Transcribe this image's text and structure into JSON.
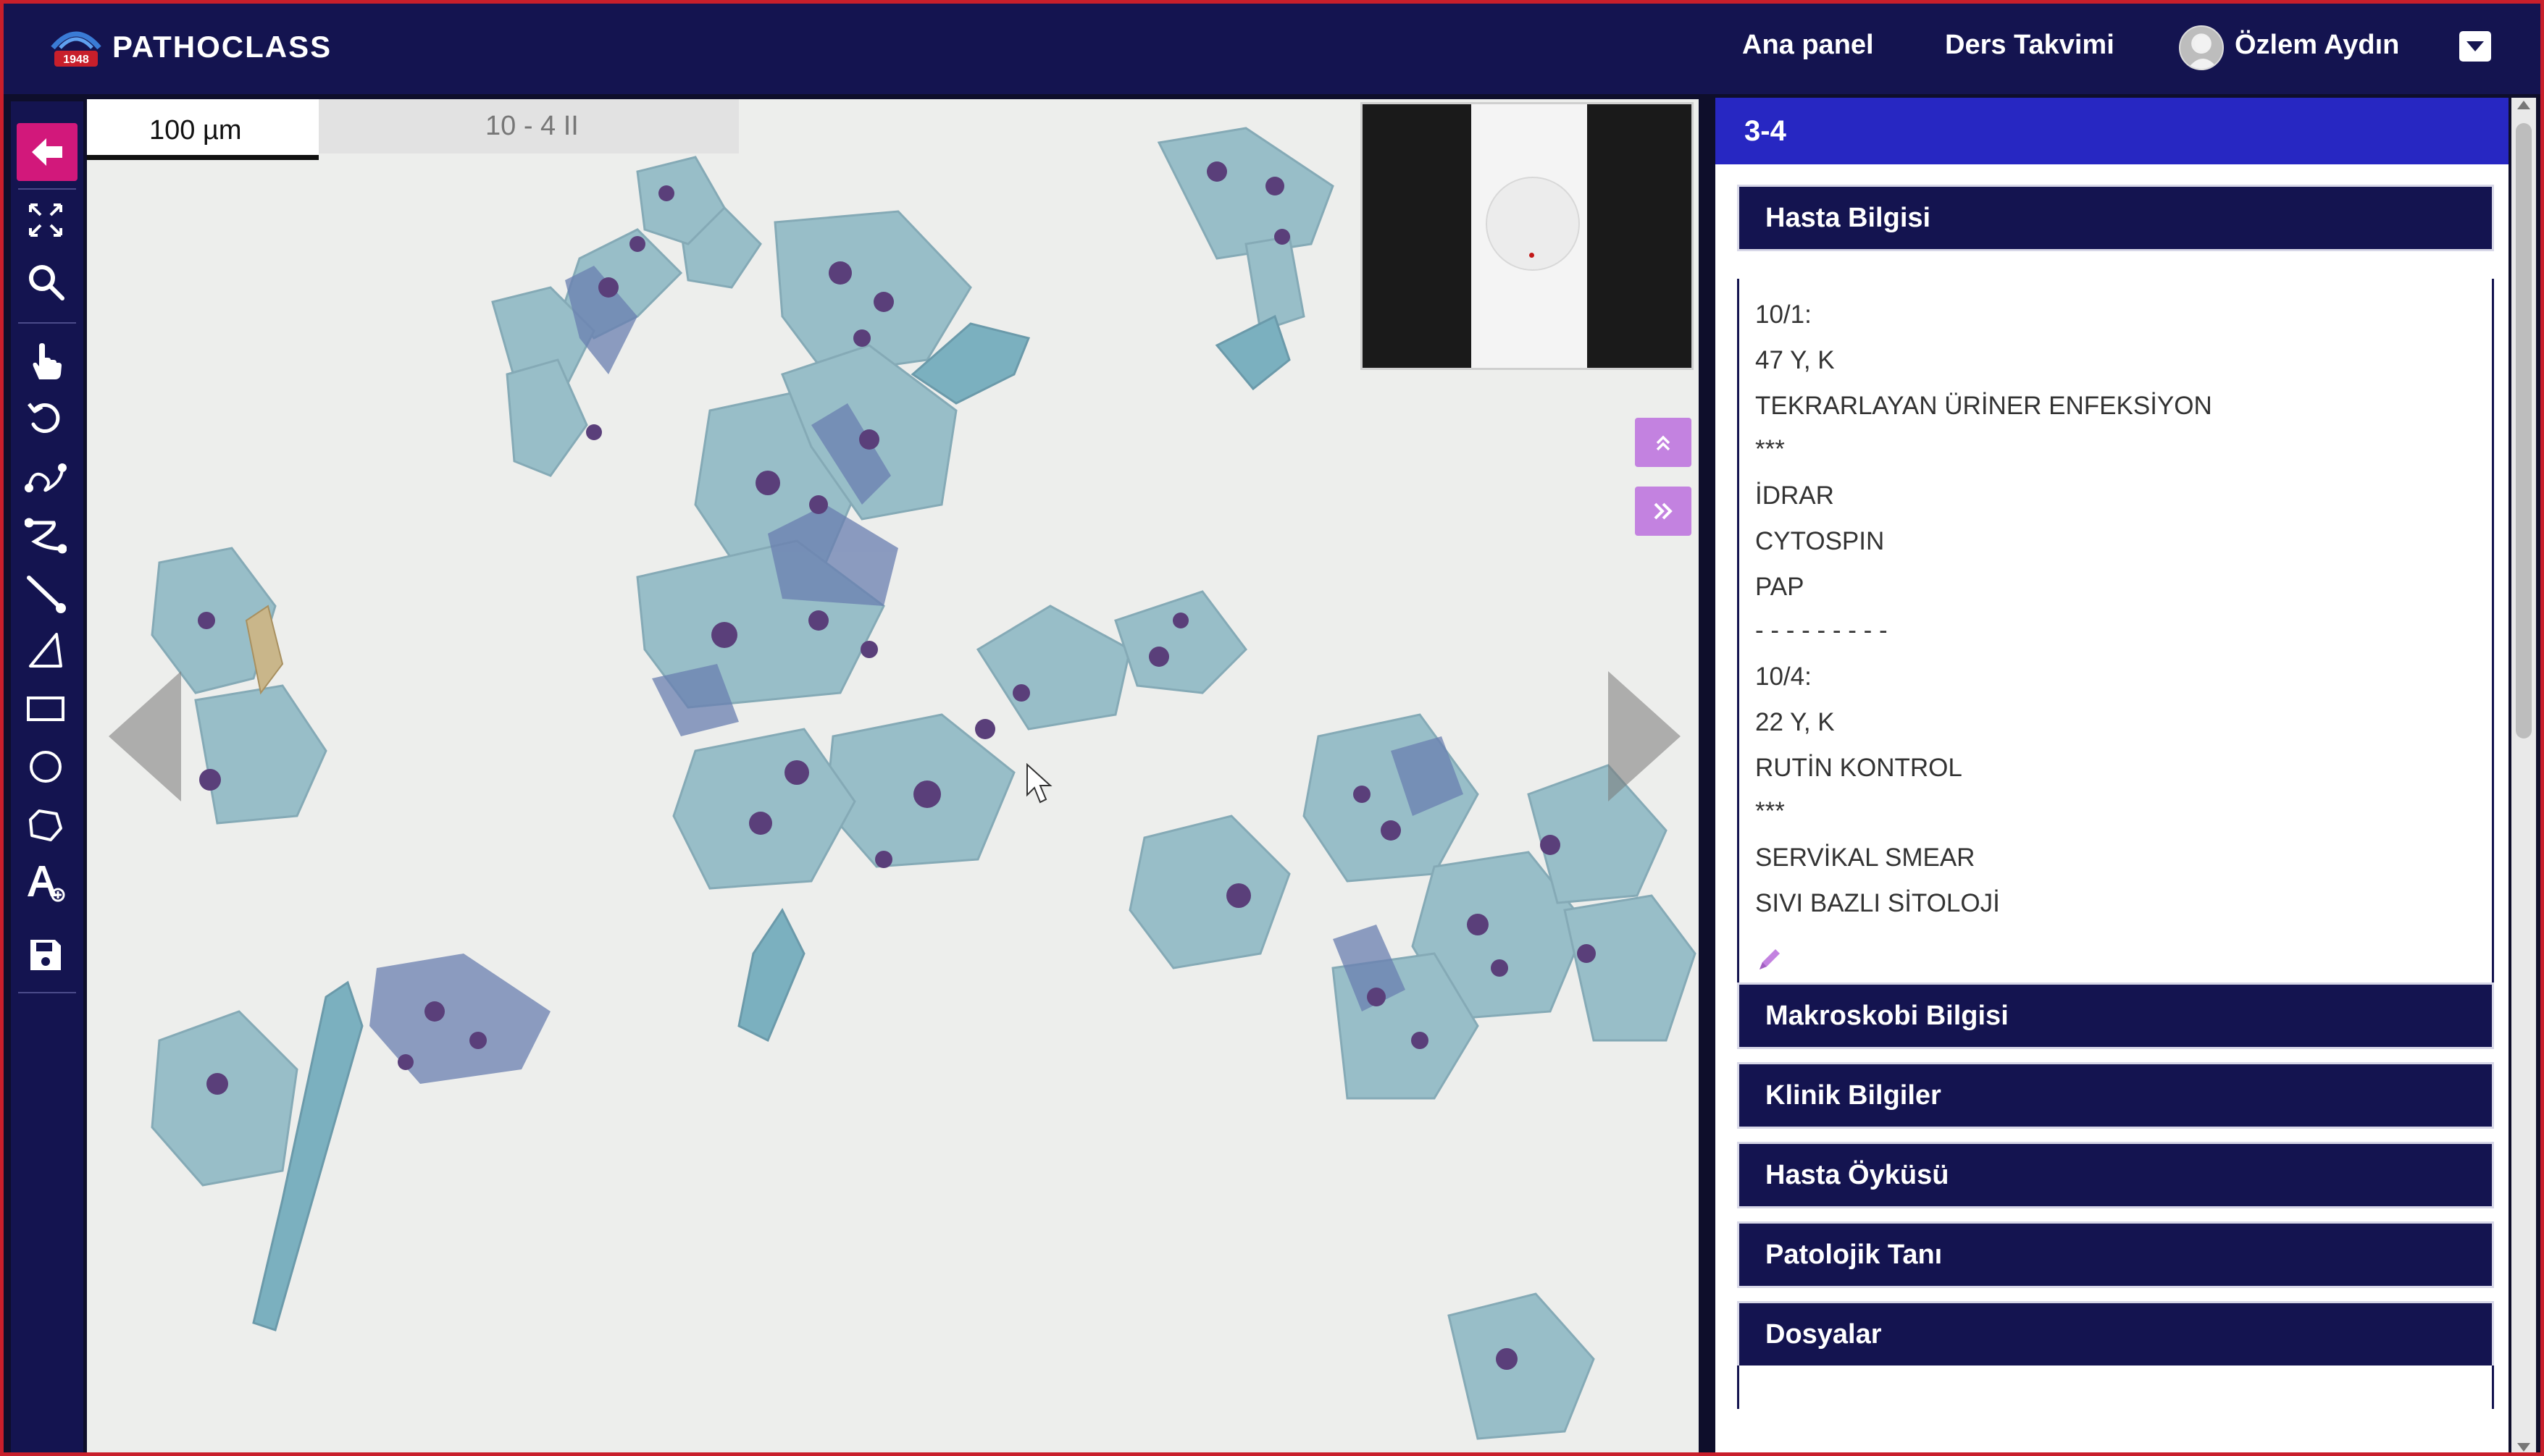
{
  "app": {
    "brand": "PATHOCLASS",
    "logo_badge": "1948"
  },
  "topbar": {
    "nav_home": "Ana panel",
    "nav_calendar": "Ders Takvimi",
    "user_name": "Özlem Aydın"
  },
  "toolbar": {
    "tools": [
      {
        "name": "back-arrow-icon",
        "active": true
      },
      {
        "name": "fullscreen-icon"
      },
      {
        "name": "zoom-icon"
      },
      {
        "name": "pan-hand-icon"
      },
      {
        "name": "rotate-icon"
      },
      {
        "name": "freehand-icon"
      },
      {
        "name": "polyline-icon"
      },
      {
        "name": "line-icon"
      },
      {
        "name": "triangle-icon"
      },
      {
        "name": "rectangle-icon"
      },
      {
        "name": "circle-icon"
      },
      {
        "name": "polygon-icon"
      },
      {
        "name": "text-annotation-icon"
      },
      {
        "name": "save-icon"
      }
    ]
  },
  "viewer": {
    "scale_label": "100 µm",
    "magnification_label": "10 - 4 II",
    "accent_color": "#c382e0"
  },
  "panel": {
    "title": "3-4",
    "sections": {
      "patient_info": "Hasta Bilgisi",
      "macroscopy": "Makroskobi Bilgisi",
      "clinical": "Klinik Bilgiler",
      "history": "Hasta Öyküsü",
      "diagnosis": "Patolojik Tanı",
      "files": "Dosyalar"
    },
    "patient_lines": [
      "10/1:",
      "47 Y, K",
      "TEKRARLAYAN ÜRİNER ENFEKSİYON",
      "***",
      "İDRAR",
      "CYTOSPIN",
      "PAP",
      "- - - - - - - - -",
      "10/4:",
      "22 Y, K",
      "RUTİN KONTROL",
      "***",
      "SERVİKAL SMEAR",
      "SIVI BAZLI SİTOLOJİ"
    ]
  },
  "colors": {
    "topbar": "#141450",
    "panel_header": "#2727c2",
    "active_tool": "#d2187b",
    "border": "#c81f2b"
  }
}
